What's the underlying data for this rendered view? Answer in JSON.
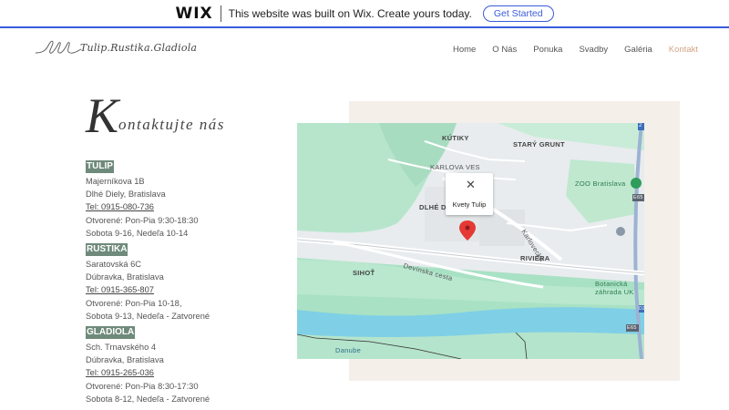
{
  "banner": {
    "logo": "WIX",
    "text": "This website was built on Wix. Create yours today.",
    "button": "Get Started"
  },
  "header": {
    "logo_text": "Tulip.Rustika.Gladiola",
    "nav": [
      "Home",
      "O Nás",
      "Ponuka",
      "Svadby",
      "Galéria",
      "Kontakt"
    ],
    "active": "Kontakt"
  },
  "page": {
    "heading_initial": "K",
    "heading_rest": "ontaktujte nás"
  },
  "shops": [
    {
      "name": "TULIP",
      "lines": [
        "Majerníkova 1B",
        "Dlhé Diely, Bratislava",
        "Tel: 0915-080-736",
        "Otvorené: Pon-Pia 9:30-18:30",
        "Sobota 9-16, Nedeľa 10-14"
      ]
    },
    {
      "name": "RUSTIKA",
      "lines": [
        "Saratovská 6C",
        "Dúbravka, Bratislava",
        "Tel: 0915-365-807",
        "Otvorené: Pon-Pia 10-18,",
        "Sobota 9-13, Nedeľa - Zatvorené"
      ]
    },
    {
      "name": "GLADIOLA",
      "lines": [
        "Sch. Trnavského 4",
        "Dúbravka, Bratislava",
        "Tel: 0915-265-036",
        "Otvorené: Pon-Pia 8:30-17:30",
        "Sobota 8-12, Nedeľa - Zatvorené"
      ]
    }
  ],
  "map": {
    "labels": {
      "kutiky": "KÚTIKY",
      "stary_grunt": "STARÝ GRUNT",
      "karlova_ves": "KARLOVA VES",
      "zoo": "ZOO Bratislava",
      "dlhe_diely": "DLHÉ D",
      "karlovecka": "Karlovecká",
      "riviera": "RIVIÉRA",
      "sihot": "SIHOŤ",
      "devinska": "Devínska cesta",
      "botanicka": "Botanická",
      "zahrada": "záhrada UK",
      "danube": "Danube",
      "road2": "2",
      "e65a": "E65",
      "e65b": "E65",
      "d2": "D2"
    },
    "popup_name": "Kvety Tulip"
  }
}
